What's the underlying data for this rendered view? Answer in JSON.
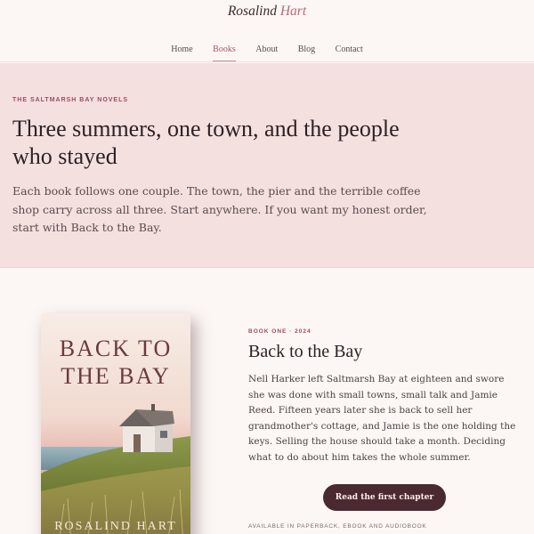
{
  "header": {
    "brand_first": "Rosalind",
    "brand_last": "Hart",
    "nav": [
      {
        "label": "Home",
        "active": false
      },
      {
        "label": "Books",
        "active": true
      },
      {
        "label": "About",
        "active": false
      },
      {
        "label": "Blog",
        "active": false
      },
      {
        "label": "Contact",
        "active": false
      }
    ]
  },
  "hero": {
    "eyebrow": "THE SALTMARSH BAY NOVELS",
    "title": "Three summers, one town, and the people who stayed",
    "text": "Each book follows one couple. The town, the pier and the terrible coffee shop carry across all three. Start anywhere. If you want my honest order, start with Back to the Bay."
  },
  "book": {
    "cover_title": "BACK TO THE BAY",
    "cover_author": "ROSALIND HART",
    "eyebrow": "BOOK ONE · 2024",
    "title": "Back to the Bay",
    "description": "Nell Harker left Saltmarsh Bay at eighteen and swore she was done with small towns, small talk and Jamie Reed. Fifteen years later she is back to sell her grandmother's cottage, and Jamie is the one holding the keys. Selling the house should take a month. Deciding what to do about him takes the whole summer.",
    "cta_label": "Read the first chapter",
    "availability": "AVAILABLE IN PAPERBACK, EBOOK AND AUDIOBOOK"
  },
  "colors": {
    "accent": "#a04a5e",
    "hero_bg": "#f4e0df",
    "page_bg": "#fcf7f5",
    "button_bg": "#4a2a30"
  }
}
